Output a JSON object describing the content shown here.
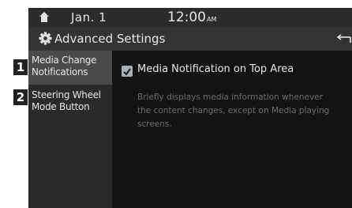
{
  "status": {
    "date": "Jan.  1",
    "time": "12:00",
    "ampm": "AM"
  },
  "titlebar": {
    "title": "Advanced Settings"
  },
  "sidebar": {
    "items": [
      {
        "badge": "1",
        "line1": "Media Change",
        "line2": "Notifications",
        "selected": true
      },
      {
        "badge": "2",
        "line1": "Steering Wheel",
        "line2": "Mode Button",
        "selected": false
      }
    ]
  },
  "content": {
    "option_label": "Media Notification on Top Area",
    "option_checked": true,
    "description_lines": [
      "Briefly displays media information whenever",
      "the content changes, except on Media playing",
      "screens."
    ]
  },
  "icons": {
    "home": "home-icon",
    "gear": "gear-icon",
    "back": "back-icon",
    "check": "check-icon"
  },
  "colors": {
    "screen_bg": "#191919",
    "sidebar_bg": "#2a2a2a",
    "selected_bg": "#4a4a4a",
    "text": "#e6e6e6",
    "description": "#6d6d6d"
  }
}
